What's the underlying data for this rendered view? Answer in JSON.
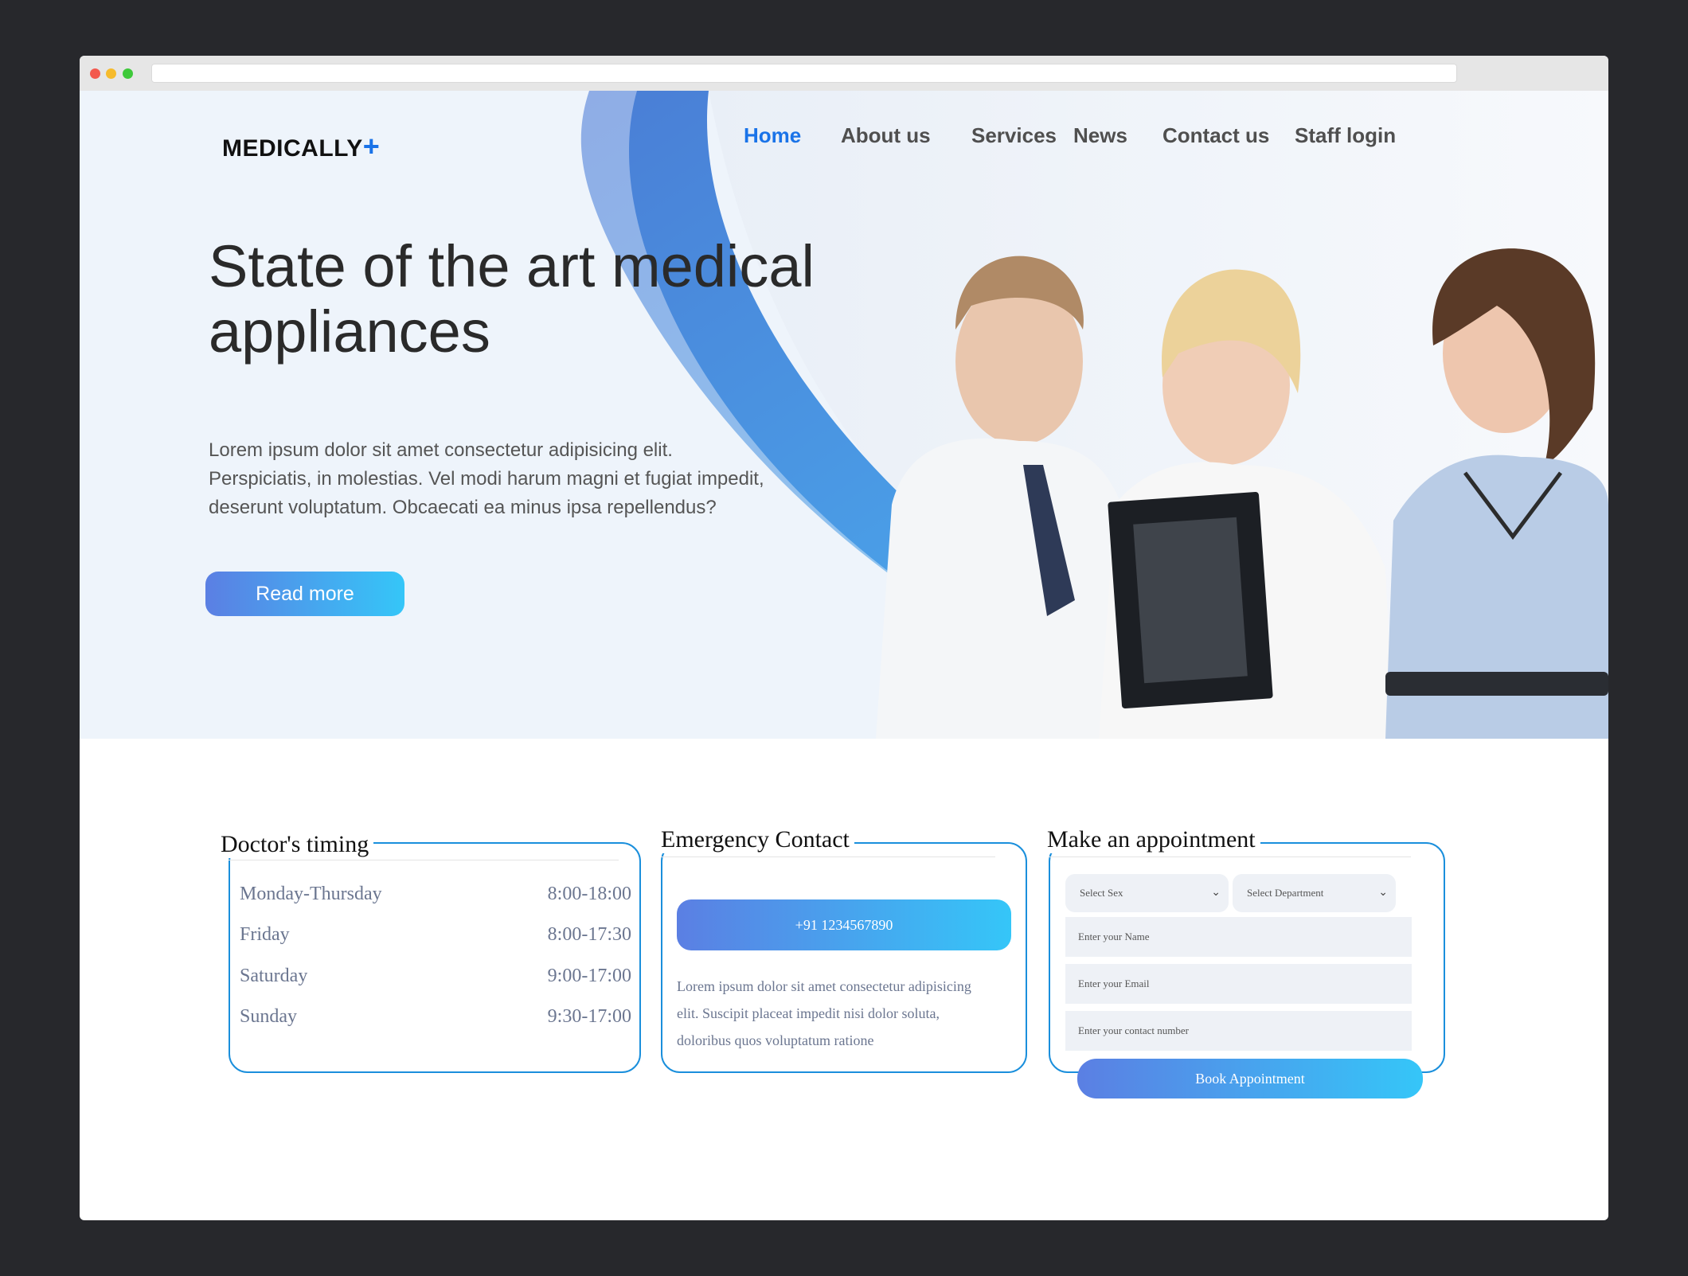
{
  "brand": {
    "name": "MEDICALLY",
    "mark": "+"
  },
  "nav": {
    "items": [
      {
        "label": "Home",
        "active": true
      },
      {
        "label": "About us",
        "active": false
      },
      {
        "label": "Services",
        "active": false
      },
      {
        "label": "News",
        "active": false
      },
      {
        "label": "Contact us",
        "active": false
      },
      {
        "label": "Staff login",
        "active": false
      }
    ]
  },
  "hero": {
    "title_line1": "State of the art medical",
    "title_line2": "appliances",
    "text_line1": "Lorem ipsum dolor sit amet consectetur adipisicing elit.",
    "text_line2": "Perspiciatis, in molestias. Vel modi harum magni et fugiat impedit,",
    "text_line3": "deserunt voluptatum. Obcaecati ea minus ipsa repellendus?",
    "cta": "Read more"
  },
  "timing": {
    "title": "Doctor's timing",
    "rows": [
      {
        "day": "Monday-Thursday",
        "time": "8:00-18:00"
      },
      {
        "day": "Friday",
        "time": "8:00-17:30"
      },
      {
        "day": "Saturday",
        "time": "9:00-17:00"
      },
      {
        "day": "Sunday",
        "time": "9:30-17:00"
      }
    ]
  },
  "emergency": {
    "title": "Emergency Contact",
    "phone": "+91 1234567890",
    "text_line1": "Lorem ipsum dolor sit amet consectetur adipisicing",
    "text_line2": "elit. Suscipit placeat impedit nisi dolor soluta,",
    "text_line3": "doloribus quos voluptatum ratione"
  },
  "appointment": {
    "title": "Make an appointment",
    "sex_select": "Select Sex",
    "dept_select": "Select Department",
    "name_placeholder": "Enter your Name",
    "email_placeholder": "Enter your Email",
    "contact_placeholder": "Enter your contact number",
    "submit": "Book Appointment"
  },
  "colors": {
    "accent": "#1a73e8",
    "gradient_start": "#5b7fe3",
    "gradient_end": "#35c6f8",
    "card_border": "#1a8fdc",
    "page_bg": "#27282c"
  }
}
